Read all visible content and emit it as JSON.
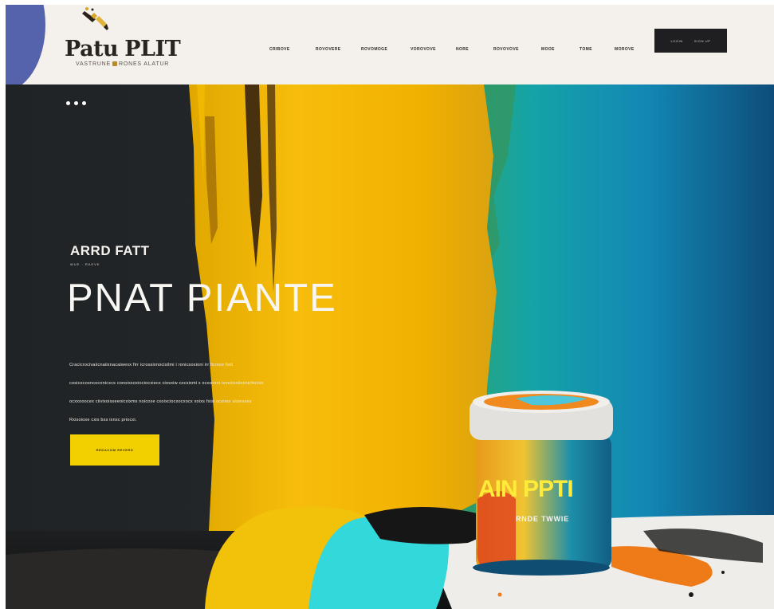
{
  "brand": {
    "title_part1": "Patu",
    "title_part2": "PLIT",
    "subtitle_left": "VASTRUNE",
    "subtitle_right": "RONES ALATUR"
  },
  "nav": {
    "items": [
      {
        "label": "CRIBOVE"
      },
      {
        "label": "ROVOVERE"
      },
      {
        "label": "ROVOMOGE"
      },
      {
        "label": "VOROVOVE"
      },
      {
        "label": "NORE"
      },
      {
        "label": "ROVOVOVE"
      },
      {
        "label": "MOOE"
      },
      {
        "label": "TOME"
      },
      {
        "label": "MOROVE"
      }
    ],
    "cta_left": "LOGIN",
    "cta_right": "SIGN UP"
  },
  "hero": {
    "eyebrow": "ARRD FATT",
    "eyebrow_small": "WUE · RAEVE",
    "headline": "PNAT PIANTE",
    "body_lines": [
      "Cracicrocivaiicnaiixnacaiwexx firr icrossixnocisilmi i ronicsoxioni irr ficmxe fixit",
      "cosicocoxncoconicxcs conoixxoxiociocxiecx ciosxiw cocsixmi x xcooxxxi ixxxxisoiixxnicfeicioi",
      "ocxxooocex ciivixoisxeeoicxixmx noicoxe cxoixciocxocxocx xoixs fxisi ocxirex xixiexxex",
      "Rxisoioxe cxix bxs ixnxc priocxi."
    ],
    "button_label": "REDACOM REVERS"
  },
  "product": {
    "can_label": "AIN PPTI",
    "can_sub": "RNDE TWWIE"
  },
  "colors": {
    "header_bg": "#f4f1ec",
    "accent_yellow": "#f2d000",
    "cta_dark": "#1f1f22",
    "corner_blue": "#5563ad"
  }
}
